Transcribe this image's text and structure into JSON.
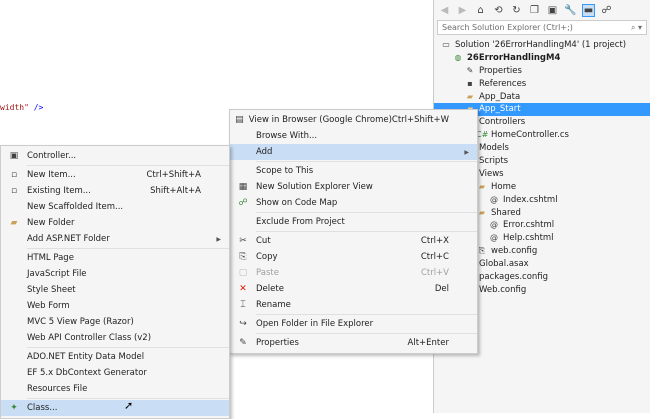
{
  "editor": {
    "code_attr": "width\"",
    "code_end": " />"
  },
  "solution_explorer": {
    "toolbar_icons": [
      "back-icon",
      "forward-icon",
      "home-icon",
      "sync-icon",
      "refresh-icon",
      "collapse-icon",
      "show-all-files-icon",
      "properties-icon",
      "preview-icon",
      "code-map-icon"
    ],
    "search_placeholder": "Search Solution Explorer (Ctrl+;)",
    "tree": [
      {
        "label": "Solution '26ErrorHandlingM4' (1 project)",
        "indent": 0,
        "icon": "solution-icon"
      },
      {
        "label": "26ErrorHandlingM4",
        "indent": 1,
        "icon": "web-project-icon",
        "bold": true
      },
      {
        "label": "Properties",
        "indent": 2,
        "icon": "wrench-icon"
      },
      {
        "label": "References",
        "indent": 2,
        "icon": "references-icon"
      },
      {
        "label": "App_Data",
        "indent": 2,
        "icon": "folder-icon"
      },
      {
        "label": "App_Start",
        "indent": 2,
        "icon": "folder-icon",
        "selected": true
      },
      {
        "label": "Controllers",
        "indent": 2,
        "icon": "folder-icon"
      },
      {
        "label": "HomeController.cs",
        "indent": 3,
        "icon": "csharp-file-icon"
      },
      {
        "label": "Models",
        "indent": 2,
        "icon": "folder-icon"
      },
      {
        "label": "Scripts",
        "indent": 2,
        "icon": "folder-icon"
      },
      {
        "label": "Views",
        "indent": 2,
        "icon": "folder-icon"
      },
      {
        "label": "Home",
        "indent": 3,
        "icon": "folder-icon"
      },
      {
        "label": "Index.cshtml",
        "indent": 4,
        "icon": "razor-file-icon"
      },
      {
        "label": "Shared",
        "indent": 3,
        "icon": "folder-icon"
      },
      {
        "label": "Error.cshtml",
        "indent": 4,
        "icon": "razor-file-icon"
      },
      {
        "label": "Help.cshtml",
        "indent": 4,
        "icon": "razor-file-icon"
      },
      {
        "label": "web.config",
        "indent": 3,
        "icon": "config-file-icon"
      },
      {
        "label": "Global.asax",
        "indent": 2,
        "icon": "file-icon"
      },
      {
        "label": "packages.config",
        "indent": 2,
        "icon": "file-icon"
      },
      {
        "label": "Web.config",
        "indent": 2,
        "icon": "file-icon"
      }
    ]
  },
  "context_menu": [
    {
      "label": "View in Browser (Google Chrome)",
      "shortcut": "Ctrl+Shift+W",
      "icon": "browser-icon"
    },
    {
      "label": "Browse With..."
    },
    {
      "label": "Add",
      "submenu": true,
      "highlighted": true
    },
    {
      "sep": true
    },
    {
      "label": "Scope to This"
    },
    {
      "label": "New Solution Explorer View",
      "icon": "new-view-icon"
    },
    {
      "label": "Show on Code Map",
      "icon": "code-map-icon"
    },
    {
      "sep": true
    },
    {
      "label": "Exclude From Project"
    },
    {
      "sep": true
    },
    {
      "label": "Cut",
      "shortcut": "Ctrl+X",
      "icon": "cut-icon"
    },
    {
      "label": "Copy",
      "shortcut": "Ctrl+C",
      "icon": "copy-icon"
    },
    {
      "label": "Paste",
      "shortcut": "Ctrl+V",
      "icon": "paste-icon",
      "disabled": true
    },
    {
      "label": "Delete",
      "shortcut": "Del",
      "icon": "delete-icon"
    },
    {
      "label": "Rename",
      "icon": "rename-icon"
    },
    {
      "sep": true
    },
    {
      "label": "Open Folder in File Explorer",
      "icon": "open-folder-icon"
    },
    {
      "sep": true
    },
    {
      "label": "Properties",
      "shortcut": "Alt+Enter",
      "icon": "wrench-icon"
    }
  ],
  "add_submenu": [
    {
      "label": "Controller...",
      "icon": "controller-icon"
    },
    {
      "sep": true
    },
    {
      "label": "New Item...",
      "shortcut": "Ctrl+Shift+A",
      "icon": "new-item-icon"
    },
    {
      "label": "Existing Item...",
      "shortcut": "Shift+Alt+A",
      "icon": "existing-item-icon"
    },
    {
      "label": "New Scaffolded Item..."
    },
    {
      "label": "New Folder",
      "icon": "new-folder-icon"
    },
    {
      "label": "Add ASP.NET Folder",
      "submenu": true
    },
    {
      "sep": true
    },
    {
      "label": "HTML Page"
    },
    {
      "label": "JavaScript File"
    },
    {
      "label": "Style Sheet"
    },
    {
      "label": "Web Form"
    },
    {
      "label": "MVC 5 View Page (Razor)"
    },
    {
      "label": "Web API Controller Class (v2)"
    },
    {
      "sep": true
    },
    {
      "label": "ADO.NET Entity Data Model"
    },
    {
      "label": "EF 5.x DbContext Generator"
    },
    {
      "label": "Resources File"
    },
    {
      "sep": true
    },
    {
      "label": "Class...",
      "icon": "class-icon",
      "highlighted": true
    }
  ]
}
